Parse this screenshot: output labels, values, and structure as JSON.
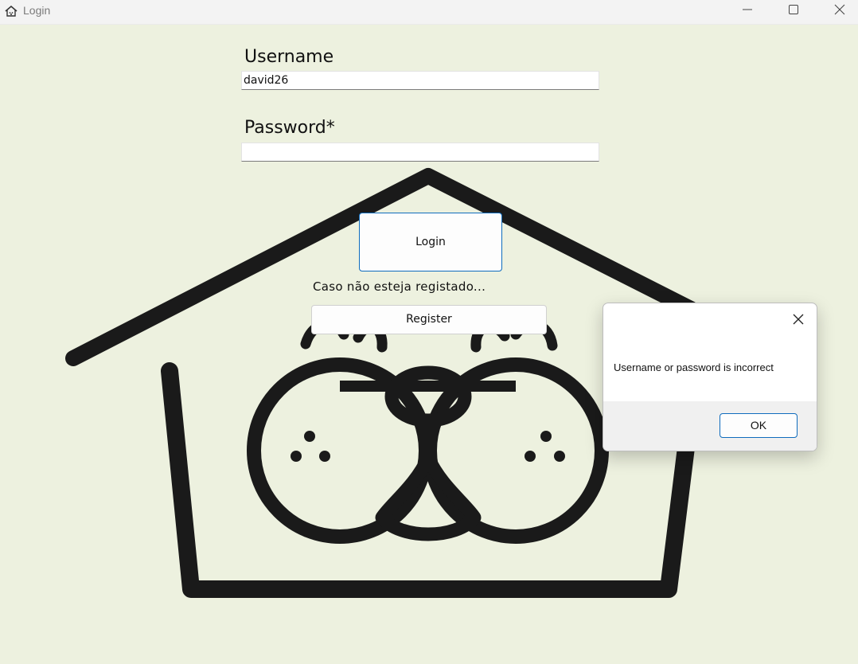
{
  "window": {
    "title": "Login",
    "icon": "house-icon",
    "controls": [
      "minimize-icon",
      "maximize-icon",
      "close-icon"
    ]
  },
  "form": {
    "username_label": "Username",
    "username_value": "david26",
    "password_label": "Password*",
    "password_value": "",
    "login_button": "Login",
    "register_hint": "Caso não esteja registado...",
    "register_button": "Register"
  },
  "background": {
    "art": "dog-house-illustration"
  },
  "dialog": {
    "message": "Username or password is incorrect",
    "ok_button": "OK",
    "close_icon": "close-icon"
  },
  "colors": {
    "background": "#edf1df",
    "accent": "#0f6cbd",
    "art": "#1a1a1a"
  }
}
